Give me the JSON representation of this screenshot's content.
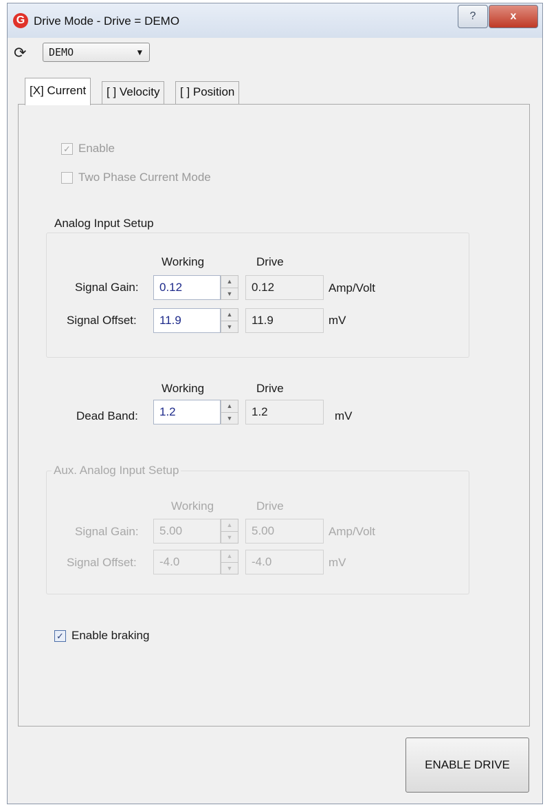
{
  "window": {
    "title": "Drive Mode - Drive = DEMO",
    "app_icon": "G"
  },
  "titlebar": {
    "help_glyph": "?",
    "close_glyph": "x"
  },
  "drive_selector": {
    "value": "DEMO"
  },
  "tabs": [
    {
      "label": "[X] Current",
      "active": true
    },
    {
      "label": "[ ] Velocity",
      "active": false
    },
    {
      "label": "[ ] Position",
      "active": false
    }
  ],
  "options": {
    "enable": {
      "label": "Enable",
      "checked": true,
      "disabled": true
    },
    "two_phase": {
      "label": "Two Phase Current Mode",
      "checked": false,
      "disabled": true
    }
  },
  "analog_input": {
    "title": "Analog Input Setup",
    "col_working": "Working",
    "col_drive": "Drive",
    "signal_gain": {
      "label": "Signal Gain:",
      "working": "0.12",
      "drive": "0.12",
      "unit": "Amp/Volt"
    },
    "signal_offset": {
      "label": "Signal Offset:",
      "working": "11.9",
      "drive": "11.9",
      "unit": "mV"
    }
  },
  "dead_band": {
    "col_working": "Working",
    "col_drive": "Drive",
    "label": "Dead Band:",
    "working": "1.2",
    "drive": "1.2",
    "unit": "mV"
  },
  "aux_analog_input": {
    "title": "Aux. Analog Input Setup",
    "col_working": "Working",
    "col_drive": "Drive",
    "signal_gain": {
      "label": "Signal Gain:",
      "working": "5.00",
      "drive": "5.00",
      "unit": "Amp/Volt"
    },
    "signal_offset": {
      "label": "Signal Offset:",
      "working": "-4.0",
      "drive": "-4.0",
      "unit": "mV"
    }
  },
  "braking": {
    "label": "Enable braking",
    "checked": true
  },
  "enable_drive_button": {
    "label": "ENABLE DRIVE"
  }
}
